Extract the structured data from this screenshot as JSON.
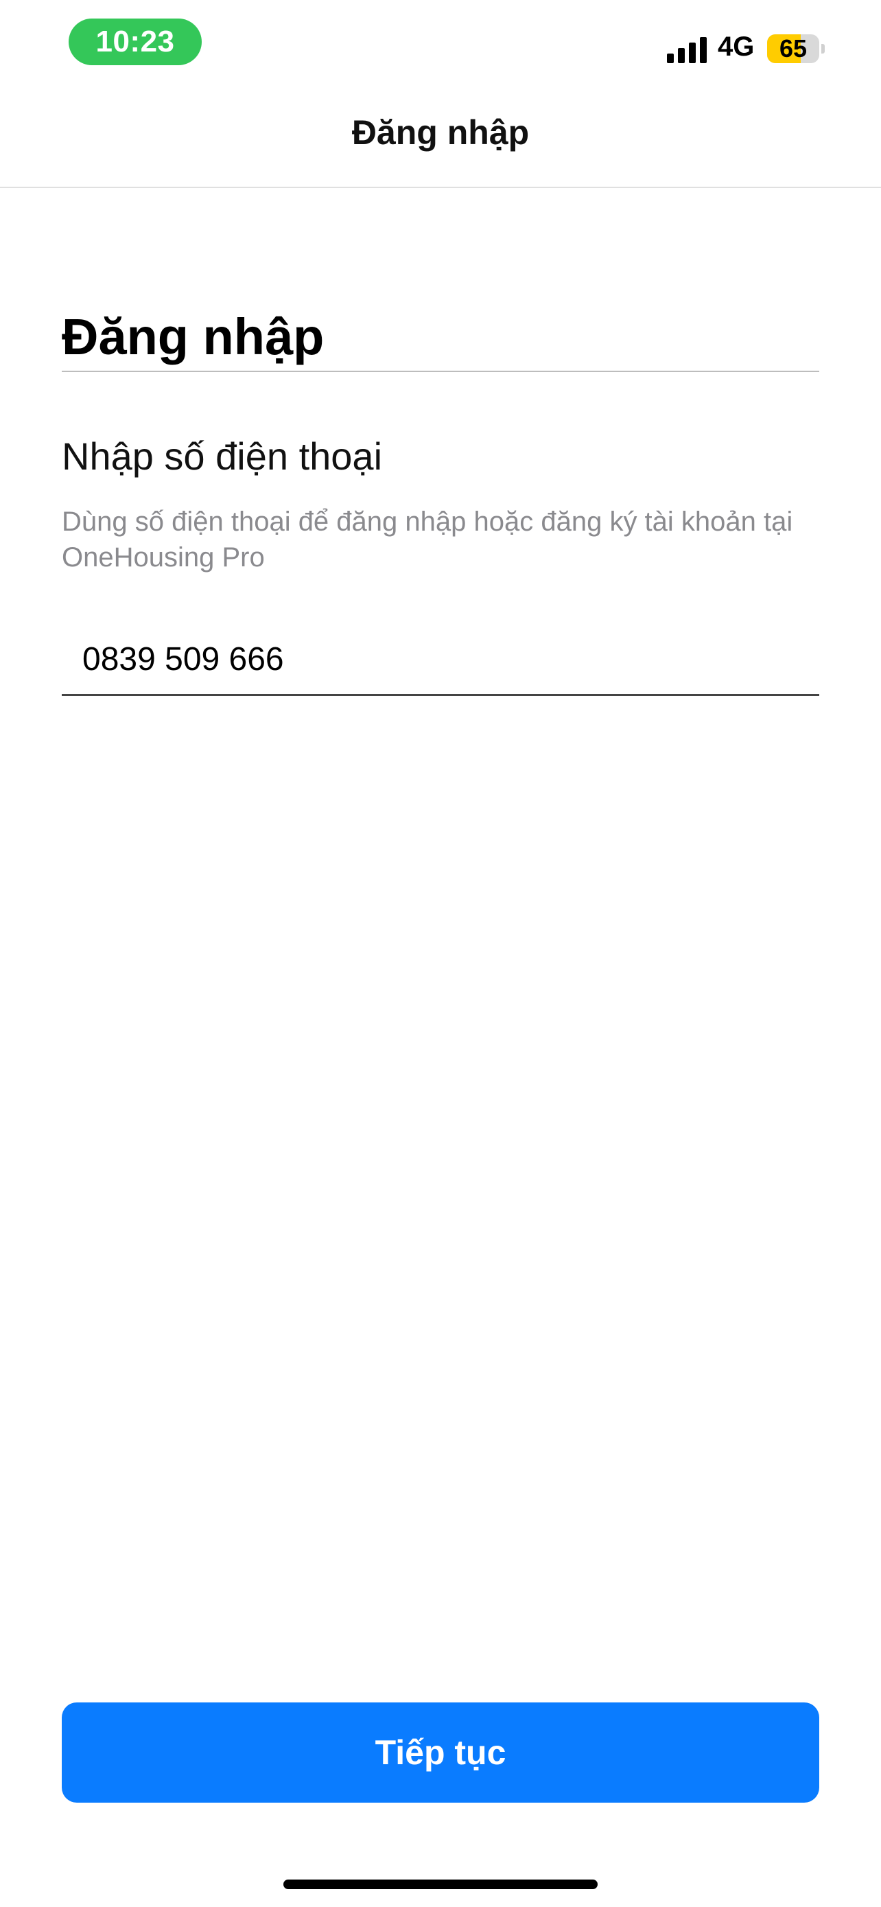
{
  "status_bar": {
    "time": "10:23",
    "network": "4G",
    "battery_percent": "65",
    "battery_level": 0.65,
    "signal_bars": 4,
    "time_pill_color": "#34c759",
    "battery_color": "#ffcc00"
  },
  "nav": {
    "title": "Đăng nhập"
  },
  "main": {
    "heading": "Đăng nhập",
    "field_label": "Nhập số điện thoại",
    "help_text": "Dùng số điện thoại để đăng nhập hoặc đăng ký tài khoản tại OneHousing Pro",
    "phone_value": "0839 509 666"
  },
  "footer": {
    "continue_label": "Tiếp tục",
    "button_color": "#0a7cff"
  }
}
